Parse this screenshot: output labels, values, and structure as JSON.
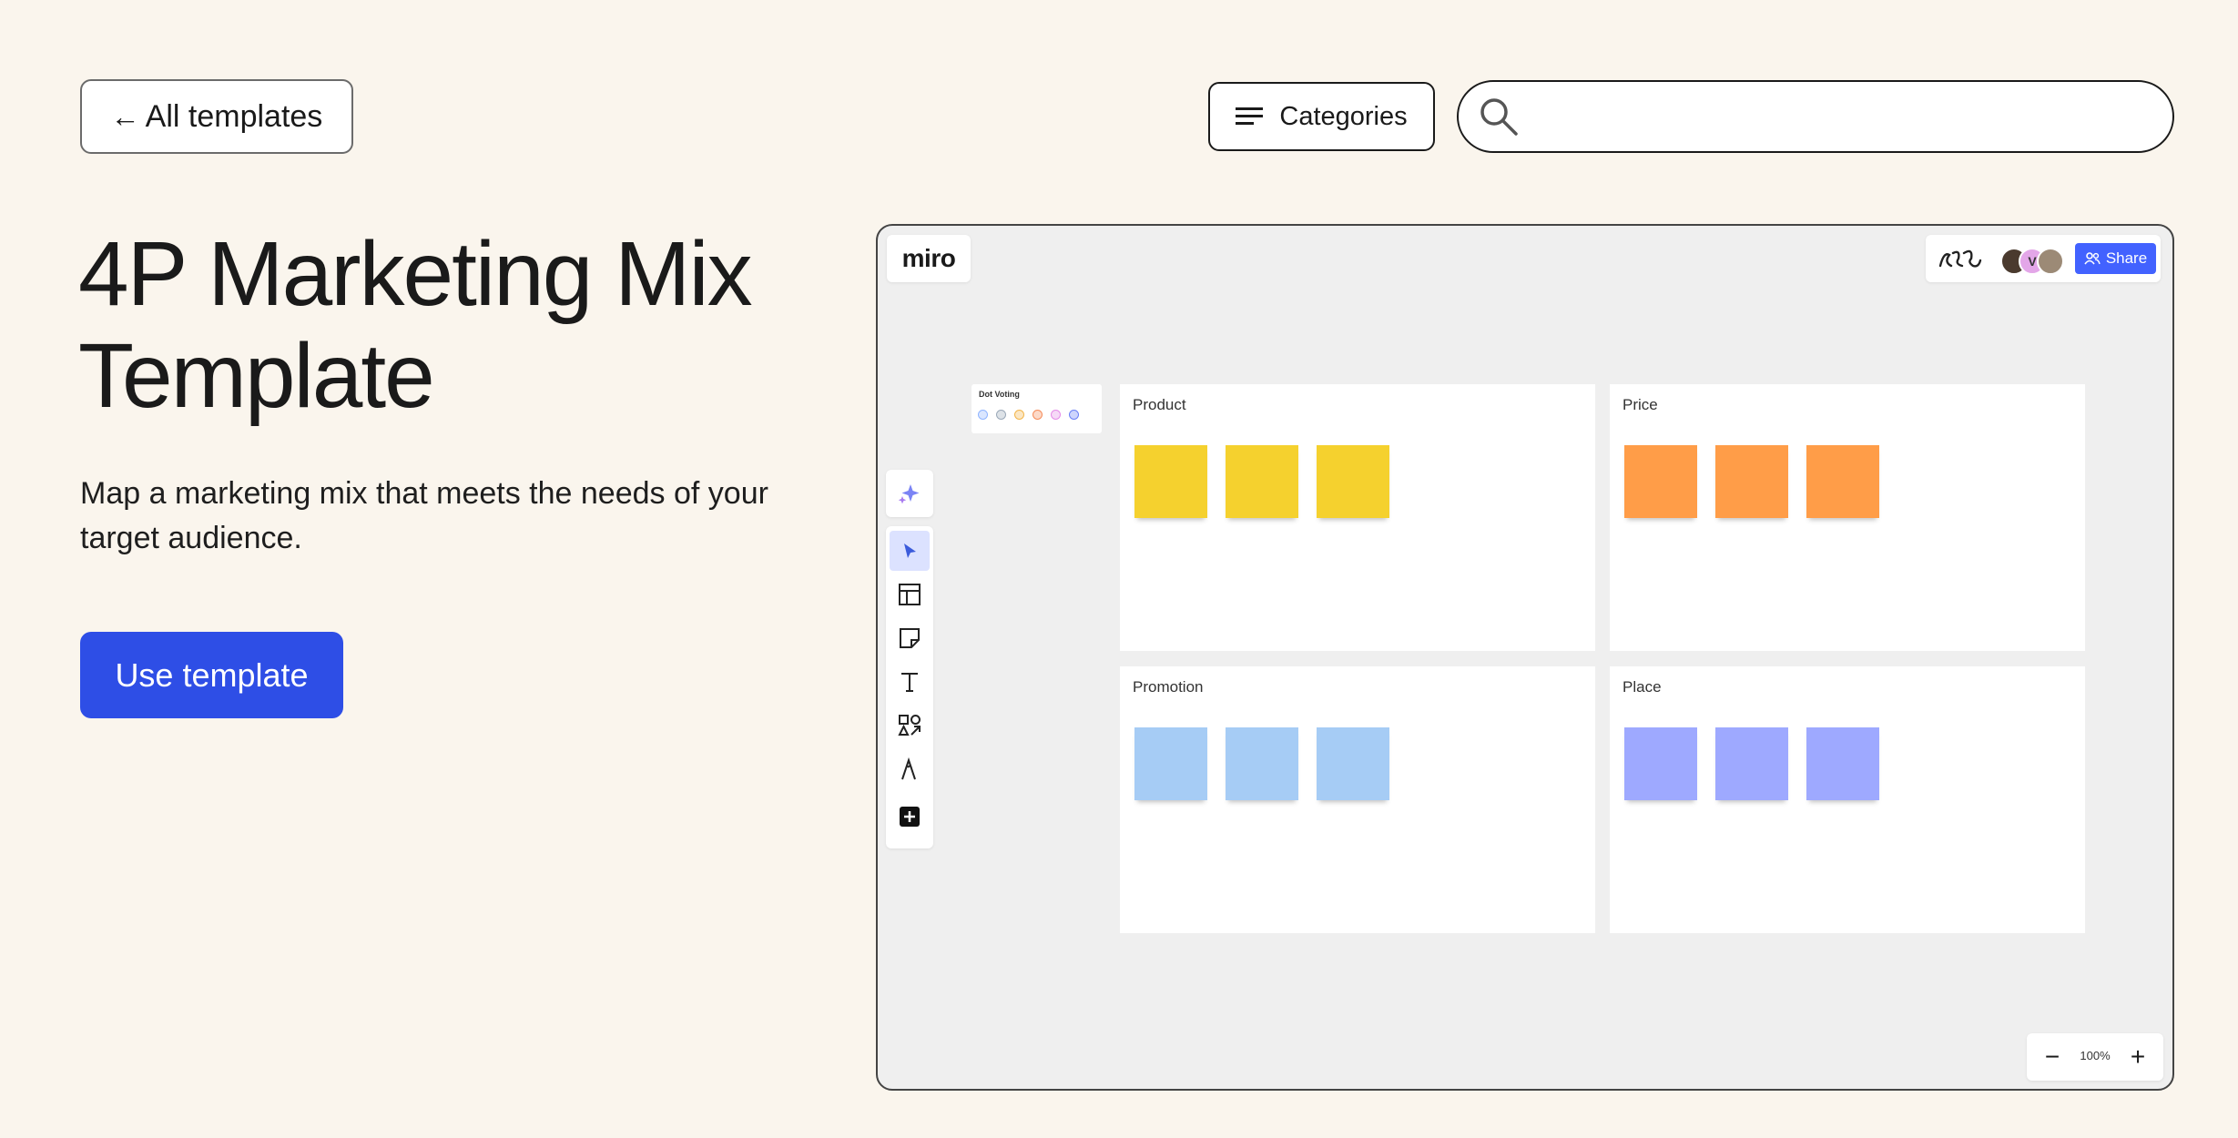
{
  "nav": {
    "back_arrow": "←",
    "back_label": "All templates",
    "categories_label": "Categories",
    "search_placeholder": ""
  },
  "hero": {
    "title": "4P Marketing Mix Template",
    "subtitle": "Map a marketing mix that meets the needs of your target audience.",
    "cta_label": "Use template"
  },
  "preview": {
    "brand": "miro",
    "share_label": "Share",
    "avatar_initial": "V",
    "dot_voting_label": "Dot Voting",
    "dot_colors": [
      "#8fb4ff",
      "#9aa8b8",
      "#f2b54b",
      "#f58c5a",
      "#e58ce8",
      "#6a80f5"
    ],
    "zoom_level": "100%",
    "zoom_minus": "−",
    "zoom_plus": "+",
    "quadrants": [
      {
        "label": "Product",
        "sticky_color": "#f5d12e"
      },
      {
        "label": "Price",
        "sticky_color": "#ff9d48"
      },
      {
        "label": "Promotion",
        "sticky_color": "#a6ccf5"
      },
      {
        "label": "Place",
        "sticky_color": "#9ea9ff"
      }
    ],
    "toolbar_icons": [
      "ai-sparkle-icon",
      "select-cursor-icon",
      "templates-icon",
      "sticky-note-icon",
      "text-icon",
      "shapes-icon",
      "pen-icon",
      "more-tools-icon"
    ]
  },
  "colors": {
    "page_bg": "#faf5ed",
    "cta_bg": "#2e4ee6",
    "share_bg": "#4262ff"
  }
}
